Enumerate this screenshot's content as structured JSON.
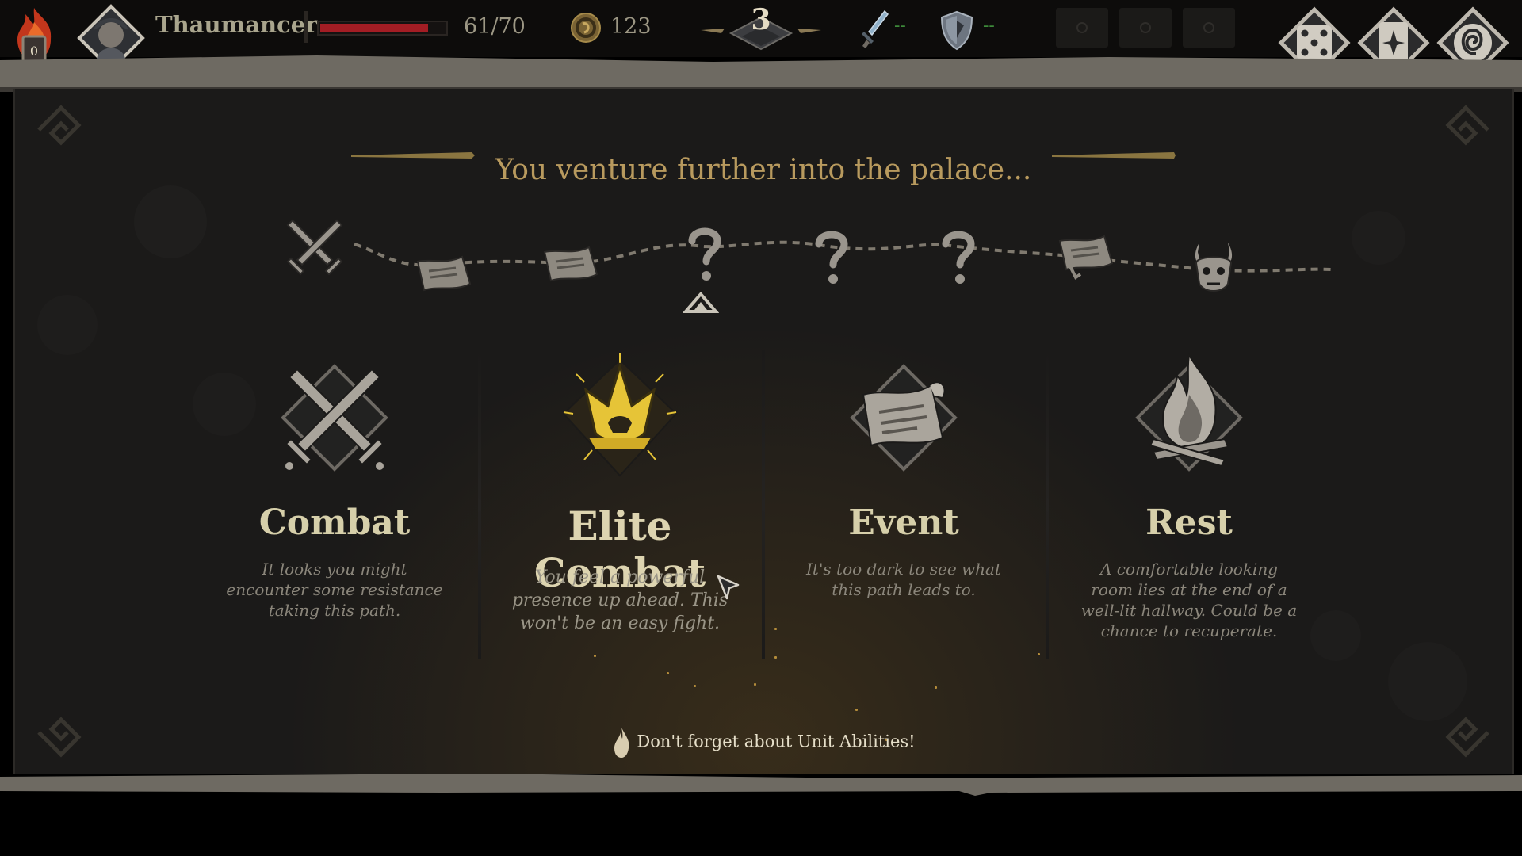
{
  "hud": {
    "embers": "0",
    "player_name": "Thaumancer",
    "hp_current": 61,
    "hp_max": 70,
    "hp_text": "61/70",
    "gold": "123",
    "floor": "3",
    "attack_bonus": "--",
    "defense_bonus": "--",
    "empty_slots": 3,
    "menu_buttons": [
      "dice-icon",
      "card-icon",
      "spiral-icon"
    ]
  },
  "map": {
    "title": "You venture further into the palace...",
    "path_nodes": [
      "combat",
      "event",
      "event",
      "unknown",
      "unknown",
      "unknown",
      "event",
      "boss"
    ],
    "current_node": "unknown"
  },
  "choices": [
    {
      "id": "combat",
      "name": "Combat",
      "desc": "It looks you might encounter some resistance taking this path."
    },
    {
      "id": "elite",
      "name": "Elite Combat",
      "desc": "You feel a powerful presence up ahead. This won't be an easy fight."
    },
    {
      "id": "event",
      "name": "Event",
      "desc": "It's too dark to see what this path leads to."
    },
    {
      "id": "rest",
      "name": "Rest",
      "desc": "A comfortable looking room lies at the end of a well-lit hallway. Could be a chance to recuperate."
    }
  ],
  "tip": "Don't forget about Unit Abilities!",
  "colors": {
    "hp": "#a31d24",
    "gold_accent": "#e6c437",
    "title": "#b89a5e",
    "stat_green": "#3d8a3a"
  }
}
